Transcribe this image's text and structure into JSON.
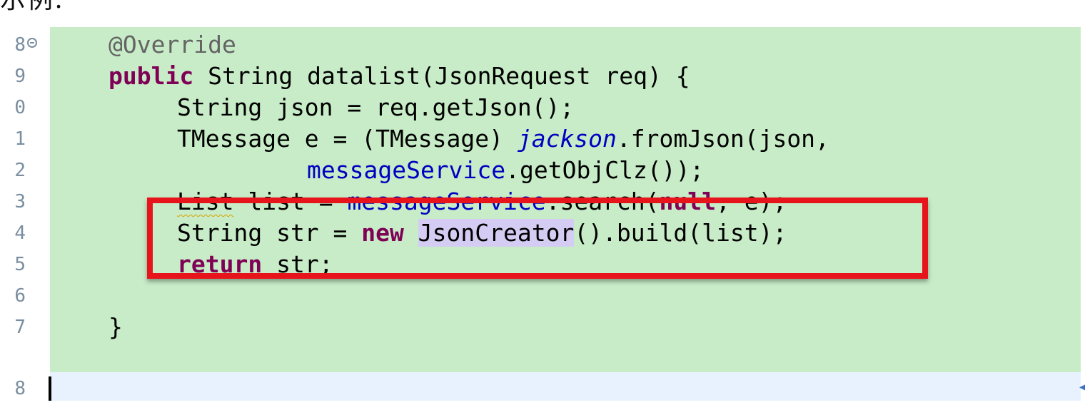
{
  "caption": "示例:",
  "editor": {
    "line_numbers": [
      "8",
      "9",
      "0",
      "1",
      "2",
      "3",
      "4",
      "5",
      "6",
      "7",
      "8"
    ],
    "lines": [
      {
        "segments": [
          {
            "text": "@Override",
            "style": "anno"
          }
        ]
      },
      {
        "segments": [
          {
            "text": "public",
            "style": "kw"
          },
          {
            "text": " String datalist(JsonRequest req) {",
            "style": "plain"
          }
        ]
      },
      {
        "segments": [
          {
            "text": "String json = req.getJson();",
            "style": "plain"
          }
        ]
      },
      {
        "segments": [
          {
            "text": "TMessage e = (TMessage) ",
            "style": "plain"
          },
          {
            "text": "jackson",
            "style": "static"
          },
          {
            "text": ".fromJson(json,",
            "style": "plain"
          }
        ]
      },
      {
        "segments": [
          {
            "text": "messageService",
            "style": "field"
          },
          {
            "text": ".getObjClz());",
            "style": "plain"
          }
        ]
      },
      {
        "segments": [
          {
            "text": "List",
            "style": "warn"
          },
          {
            "text": " list = ",
            "style": "plain"
          },
          {
            "text": "messageService",
            "style": "field"
          },
          {
            "text": ".search(",
            "style": "plain"
          },
          {
            "text": "null",
            "style": "kw"
          },
          {
            "text": ", e);",
            "style": "plain"
          }
        ]
      },
      {
        "segments": [
          {
            "text": "String str = ",
            "style": "plain"
          },
          {
            "text": "new",
            "style": "kw"
          },
          {
            "text": " ",
            "style": "plain"
          },
          {
            "text": "JsonCreator",
            "style": "occ"
          },
          {
            "text": "().build(list);",
            "style": "plain"
          }
        ]
      },
      {
        "segments": [
          {
            "text": "return",
            "style": "kw"
          },
          {
            "text": " str;",
            "style": "plain"
          }
        ]
      },
      {
        "segments": []
      },
      {
        "segments": [
          {
            "text": "}",
            "style": "plain"
          }
        ]
      },
      {
        "segments": []
      }
    ]
  },
  "colors": {
    "code_background": "#c7ecc7",
    "current_line_background": "#e8f2fe",
    "highlight_border": "#e8141c",
    "keyword": "#7f0055",
    "field": "#0000c0",
    "annotation": "#646464",
    "line_number": "#7a8ea0"
  },
  "icons": {
    "fold_marker": "collapse-minus-icon",
    "scroll_marker": "scroll-position-icon"
  }
}
